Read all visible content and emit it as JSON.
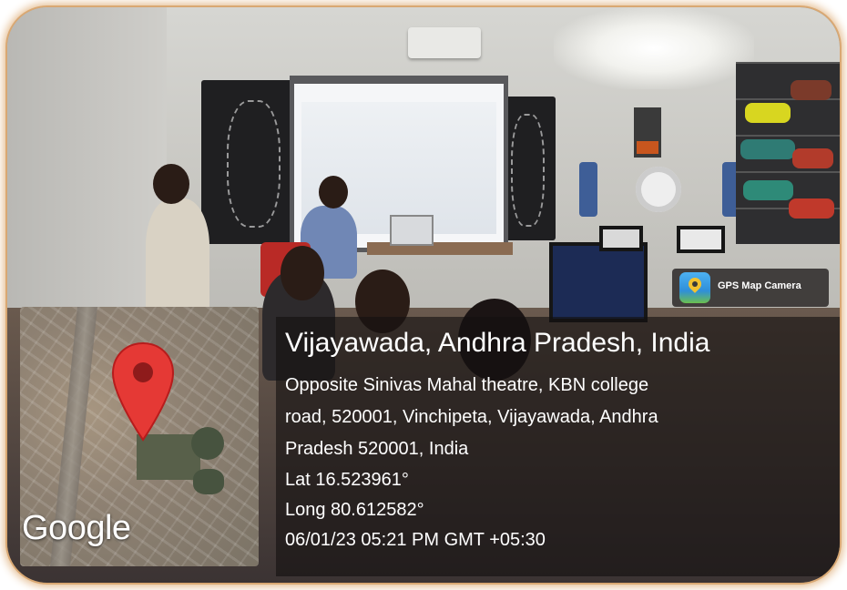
{
  "overlay": {
    "app_name": "GPS Map Camera",
    "map_watermark": "Google",
    "location_title": "Vijayawada, Andhra Pradesh, India",
    "address_lines": [
      "Opposite Sinivas Mahal theatre, KBN college",
      "road, 520001, Vinchipeta, Vijayawada, Andhra",
      "Pradesh 520001, India"
    ],
    "latitude": "Lat 16.523961°",
    "longitude": "Long 80.612582°",
    "datetime": "06/01/23 05:21 PM GMT +05:30"
  },
  "icons": {
    "pin": "map-pin-icon",
    "app": "gps-map-camera-icon"
  },
  "colors": {
    "pin_red": "#e53935",
    "frame_border": "#d9a873",
    "panel_overlay": "rgba(20,16,16,0.62)"
  }
}
